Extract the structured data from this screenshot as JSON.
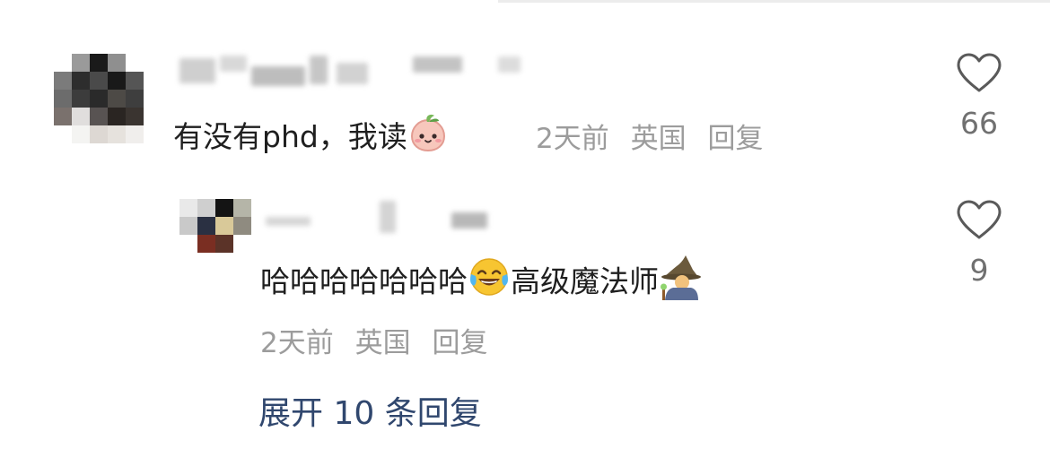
{
  "comment": {
    "text": "有没有phd，我读",
    "emoji_icon": "peach-face-emoji",
    "meta": {
      "time": "2天前",
      "location": "英国",
      "reply_label": "回复"
    },
    "like_icon": "heart-outline-icon",
    "like_count": "66"
  },
  "reply": {
    "text_prefix": "哈哈哈哈哈哈哈",
    "emoji_icon": "tears-of-joy-emoji",
    "text_suffix": "高级魔法师",
    "emoji_icon_2": "mage-emoji",
    "meta": {
      "time": "2天前",
      "location": "英国",
      "reply_label": "回复"
    },
    "like_icon": "heart-outline-icon",
    "like_count": "9"
  },
  "expand_replies": "展开 10 条回复",
  "colors": {
    "text": "#1f1f1f",
    "meta": "#9c9c9c",
    "like_count": "#707070",
    "expand_link": "#30476e",
    "heart_stroke": "#5a5a5a"
  }
}
